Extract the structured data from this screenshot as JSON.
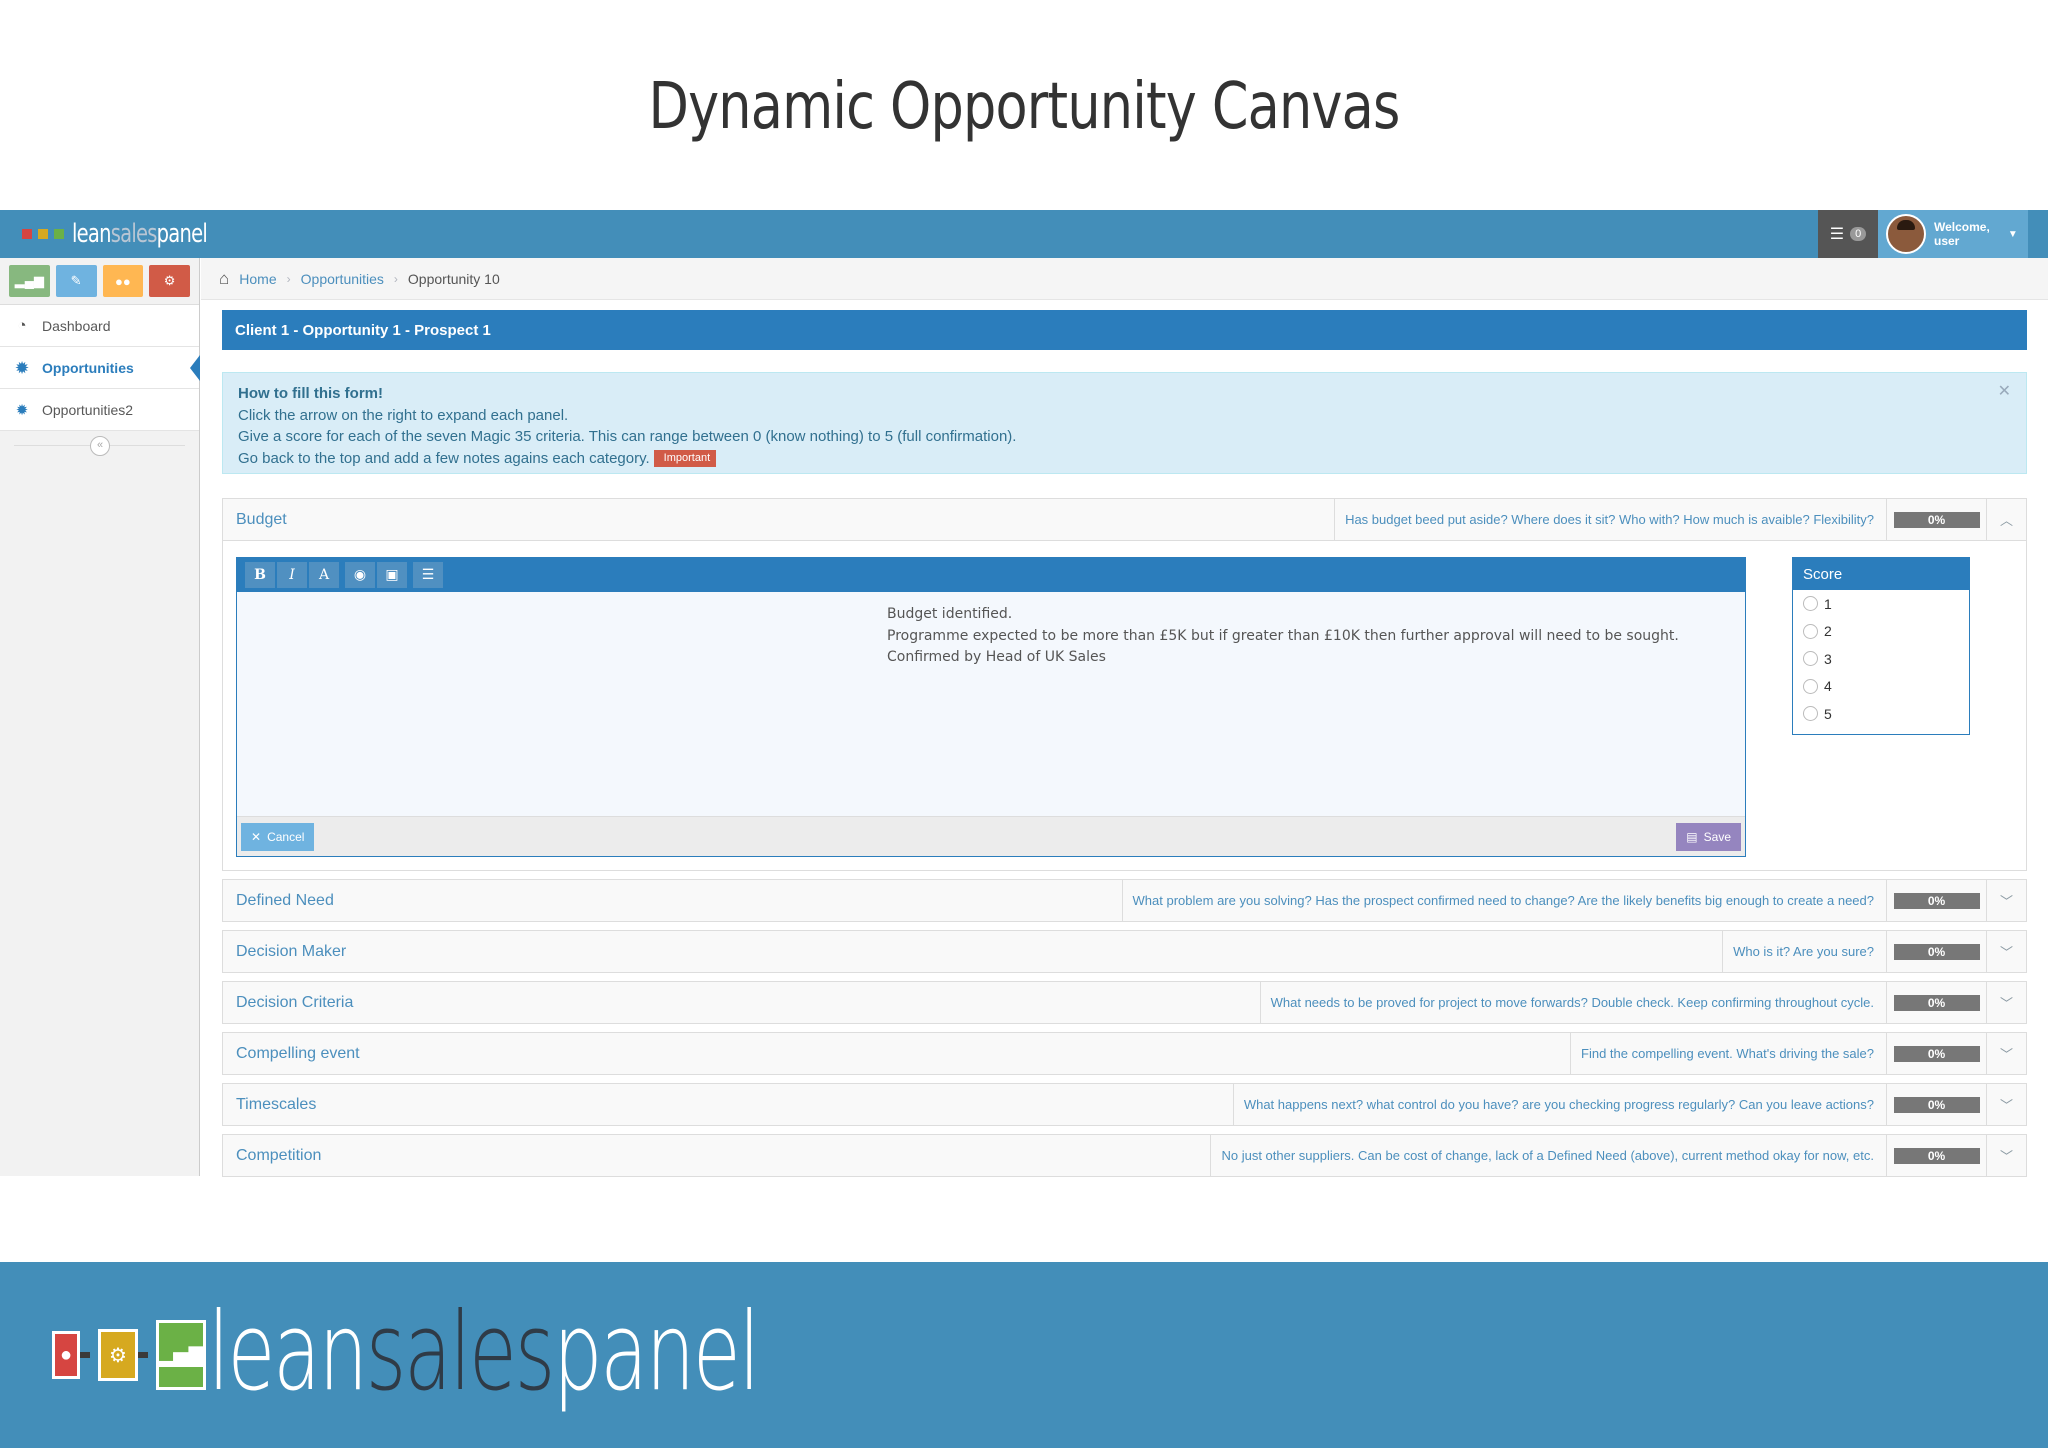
{
  "slide": {
    "title": "Dynamic Opportunity Canvas"
  },
  "navbar": {
    "brand": {
      "part1": "lean",
      "part2": "sales",
      "part3": "panel"
    },
    "notifications_count": "0",
    "welcome": "Welcome,",
    "username": "user"
  },
  "sidebar": {
    "shortcuts": [
      {
        "icon": "signal-icon",
        "color": "#87b87f"
      },
      {
        "icon": "pencil-icon",
        "color": "#6fb3e0"
      },
      {
        "icon": "group-icon",
        "color": "#ffb752"
      },
      {
        "icon": "cogs-icon",
        "color": "#d15b47"
      }
    ],
    "items": [
      {
        "label": "Dashboard",
        "icon": "dashboard-icon"
      },
      {
        "label": "Opportunities",
        "icon": "gear-icon"
      },
      {
        "label": "Opportunities2",
        "icon": "gear-icon"
      }
    ]
  },
  "breadcrumb": {
    "home": "Home",
    "section": "Opportunities",
    "current": "Opportunity 10"
  },
  "opportunity": {
    "title": "Client 1 - Opportunity 1 - Prospect 1"
  },
  "info": {
    "heading": "How to fill this form!",
    "line1": "Click the arrow on the right to expand each panel.",
    "line2": "Give a score for each of the seven Magic 35 criteria. This can range between 0 (know nothing) to 5 (full confirmation).",
    "line3": "Go back to the top and add a few notes agains each category.",
    "badge": "Important"
  },
  "panels": [
    {
      "title": "Budget",
      "hint": "Has budget beed put aside? Where does it sit? Who with? How much is avaible? Flexibility?",
      "percent": "0%"
    },
    {
      "title": "Defined Need",
      "hint": "What problem are you solving? Has the prospect confirmed need to change? Are the likely benefits big enough to create a need?",
      "percent": "0%"
    },
    {
      "title": "Decision Maker",
      "hint": "Who is it? Are you sure?",
      "percent": "0%"
    },
    {
      "title": "Decision Criteria",
      "hint": "What needs to be proved for project to move forwards? Double check. Keep confirming throughout cycle.",
      "percent": "0%"
    },
    {
      "title": "Compelling event",
      "hint": "Find the compelling event. What's driving the sale?",
      "percent": "0%"
    },
    {
      "title": "Timescales",
      "hint": "What happens next? what control do you have? are you checking progress regularly? Can you leave actions?",
      "percent": "0%"
    },
    {
      "title": "Competition",
      "hint": "No just other suppliers. Can be cost of change, lack of a Defined Need (above), current method okay for now, etc.",
      "percent": "0%"
    }
  ],
  "editor": {
    "toolbar": [
      "B",
      "I",
      "A"
    ],
    "lines": [
      "Budget identified.",
      "Programme expected to be more than £5K but if greater than £10K then further approval will need to be sought.",
      "Confirmed by Head of UK Sales"
    ],
    "cancel_label": "Cancel",
    "save_label": "Save"
  },
  "score": {
    "title": "Score",
    "options": [
      "1",
      "2",
      "3",
      "4",
      "5"
    ]
  },
  "footer": {
    "part1": "lean",
    "part2": "sales",
    "part3": "panel"
  }
}
